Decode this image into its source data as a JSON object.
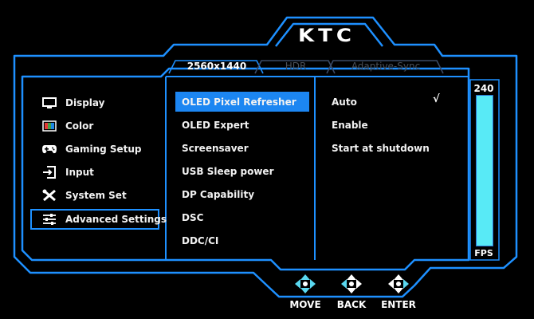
{
  "brand": {
    "logo_text": "KTC"
  },
  "top_tabs": [
    {
      "label": "2560x1440",
      "state": "active"
    },
    {
      "label": "HDR",
      "state": "inactive"
    },
    {
      "label": "Adaptive-Sync",
      "state": "inactive"
    }
  ],
  "sidebar": {
    "selected_index": 5,
    "items": [
      {
        "label": "Display",
        "icon": "monitor-icon"
      },
      {
        "label": "Color",
        "icon": "color-palette-icon"
      },
      {
        "label": "Gaming Setup",
        "icon": "gamepad-icon"
      },
      {
        "label": "Input",
        "icon": "input-icon"
      },
      {
        "label": "System Set",
        "icon": "tools-icon"
      },
      {
        "label": "Advanced Settings",
        "icon": "sliders-icon"
      }
    ]
  },
  "submenu": {
    "selected_index": 0,
    "items": [
      {
        "label": "OLED Pixel Refresher"
      },
      {
        "label": "OLED Expert"
      },
      {
        "label": "Screensaver"
      },
      {
        "label": "USB Sleep power"
      },
      {
        "label": "DP Capability"
      },
      {
        "label": "DSC"
      },
      {
        "label": "DDC/CI"
      }
    ]
  },
  "options": {
    "checked_index": 0,
    "check_mark": "√",
    "items": [
      {
        "label": "Auto"
      },
      {
        "label": "Enable"
      },
      {
        "label": "Start at shutdown"
      }
    ]
  },
  "fps_meter": {
    "max_label": "240",
    "unit_label": "FPS",
    "fill_fraction": 1.0
  },
  "nav": {
    "buttons": [
      {
        "label": "MOVE",
        "icon": "move-arrows-icon"
      },
      {
        "label": "BACK",
        "icon": "back-arrows-icon"
      },
      {
        "label": "ENTER",
        "icon": "enter-arrows-icon"
      }
    ]
  },
  "colors": {
    "frame_blue": "#1e90ff",
    "highlight_blue": "#1c86f2",
    "fps_fill": "#58eaf6",
    "inactive_text": "#4a4f57"
  }
}
